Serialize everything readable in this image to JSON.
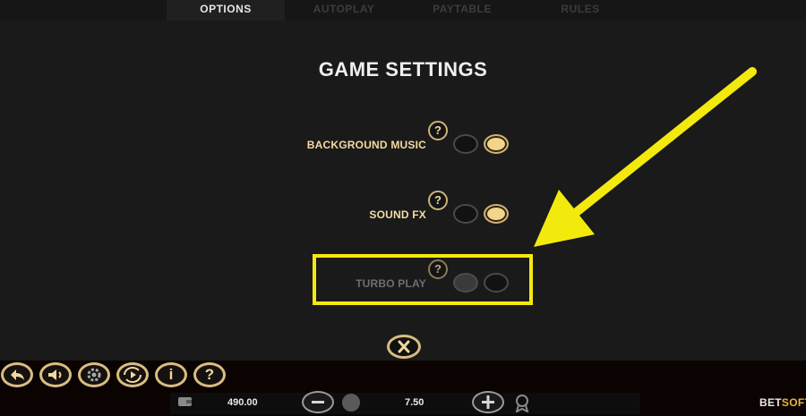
{
  "tabs": [
    {
      "label": "OPTIONS",
      "active": true
    },
    {
      "label": "AUTOPLAY",
      "active": false
    },
    {
      "label": "PAYTABLE",
      "active": false
    },
    {
      "label": "RULES",
      "active": false
    }
  ],
  "title": "GAME SETTINGS",
  "settings": [
    {
      "label": "BACKGROUND MUSIC",
      "help": "?",
      "state": "on",
      "enabled": true
    },
    {
      "label": "SOUND FX",
      "help": "?",
      "state": "on",
      "enabled": true
    },
    {
      "label": "TURBO PLAY",
      "help": "?",
      "state": "off",
      "enabled": false
    }
  ],
  "annotation": {
    "color": "#f3ea0d",
    "type": "arrow-and-box"
  },
  "close_icon": "close-icon",
  "controls": [
    {
      "name": "back-icon"
    },
    {
      "name": "sound-icon"
    },
    {
      "name": "gear-icon"
    },
    {
      "name": "autoplay-icon"
    },
    {
      "name": "info-icon",
      "text": "i"
    },
    {
      "name": "help-icon",
      "text": "?"
    }
  ],
  "footer": {
    "balance": "490.00",
    "bet": "7.50",
    "wallet_icon": "wallet-icon",
    "coins_icon": "coins-icon",
    "minus_icon": "minus-icon",
    "plus_icon": "plus-icon",
    "award_icon": "award-icon",
    "brand_part1": "BET",
    "brand_part2": "SOFT"
  },
  "colors": {
    "accent": "#d9bd80",
    "active_toggle": "#f2d58a",
    "highlight": "#f3ea0d"
  }
}
